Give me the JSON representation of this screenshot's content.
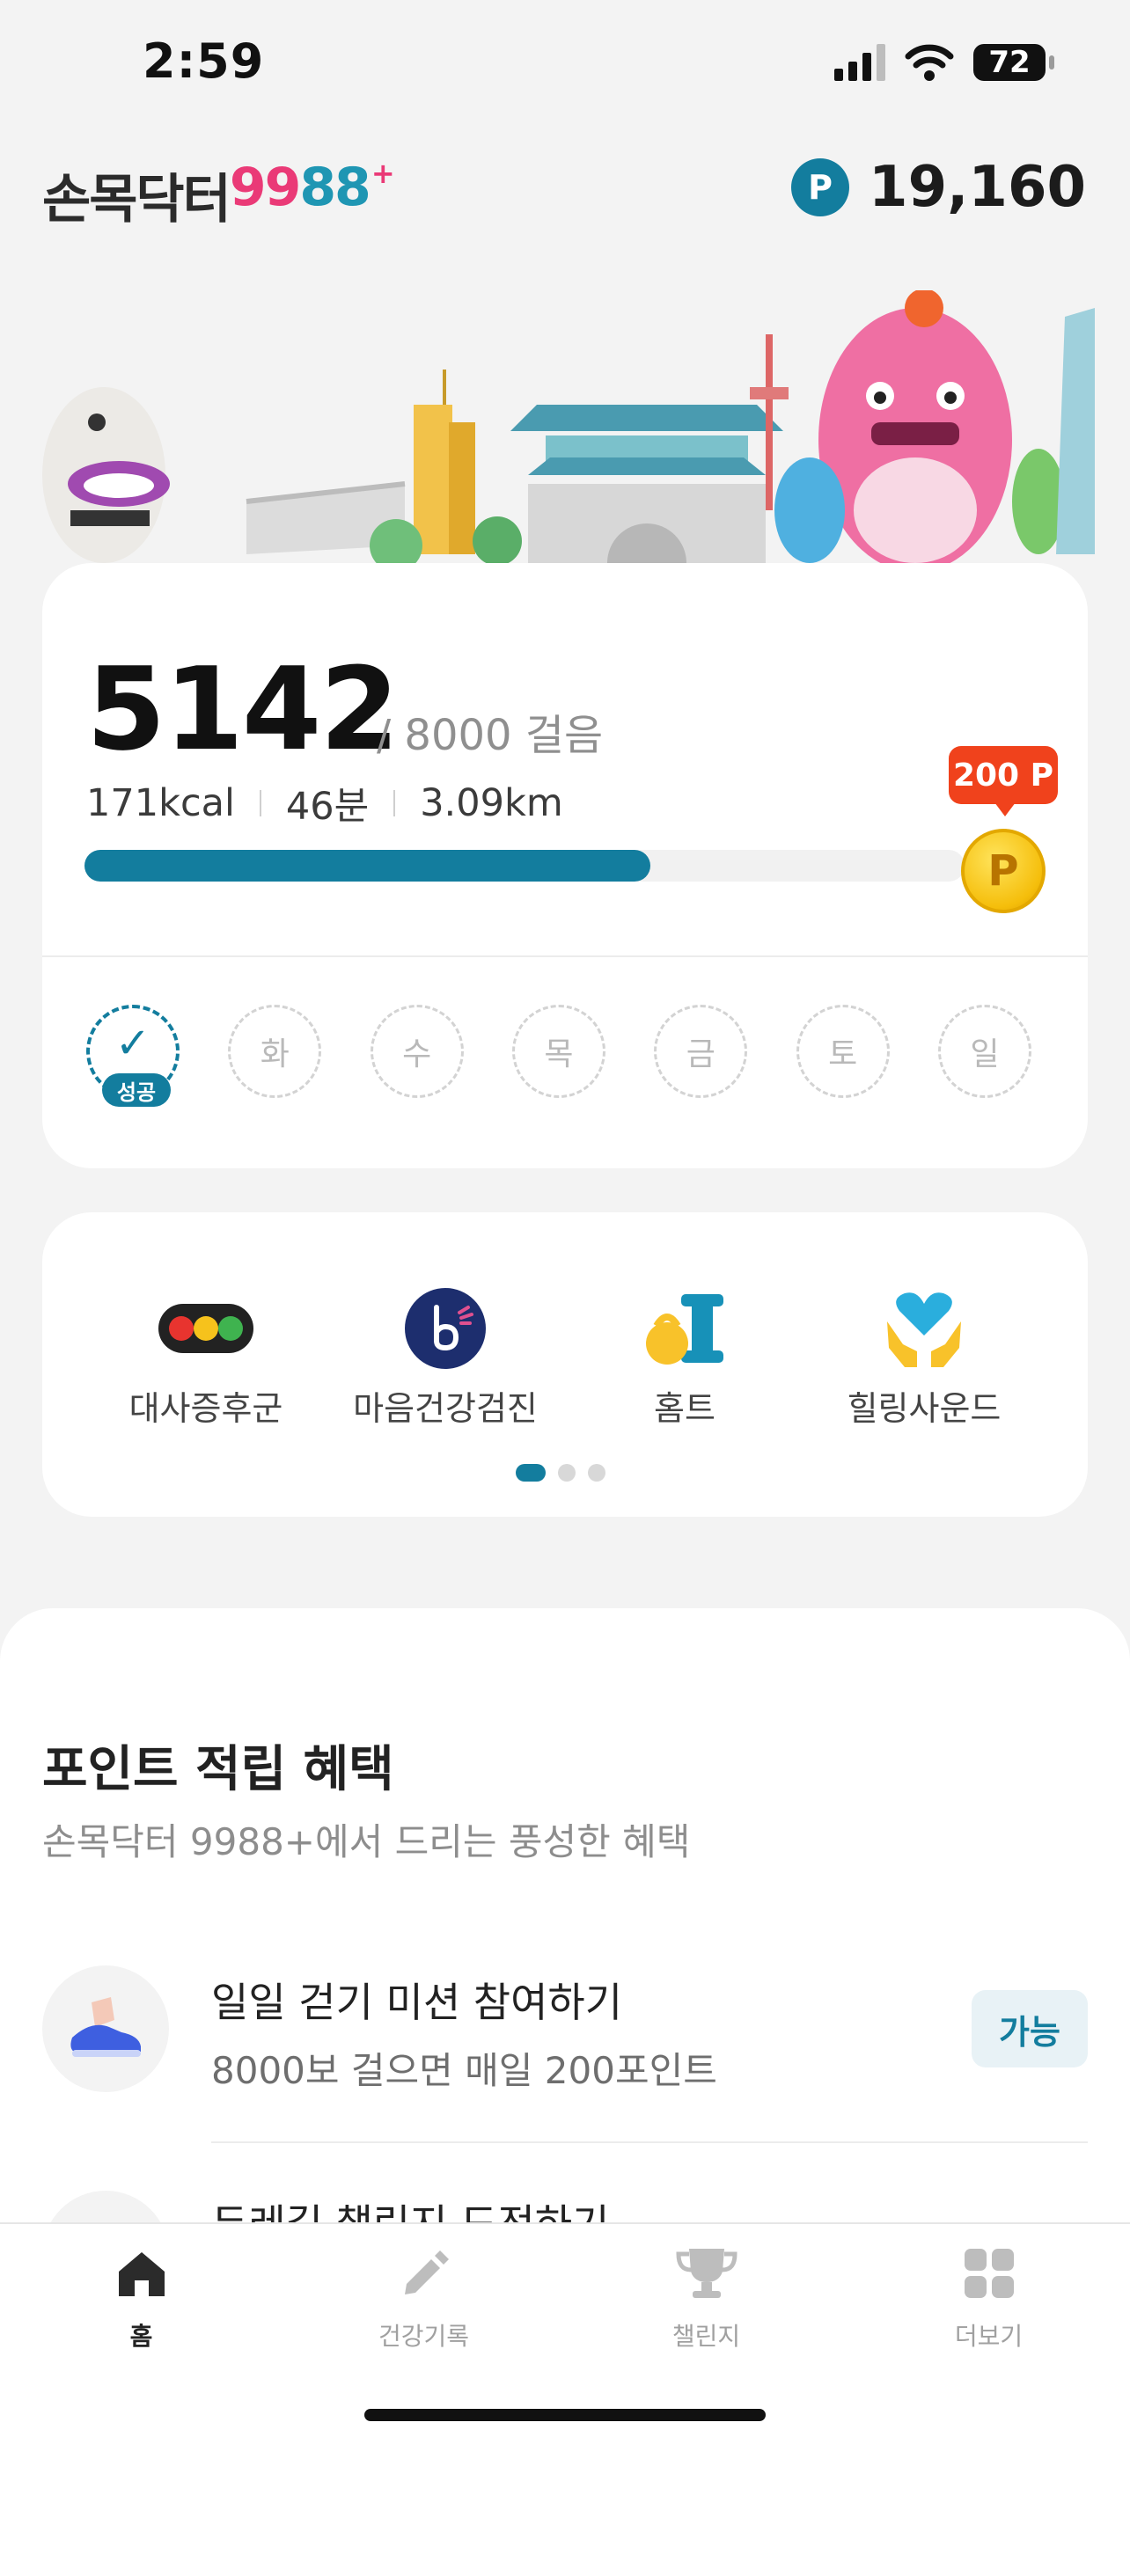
{
  "status_bar": {
    "time": "2:59",
    "battery": "72"
  },
  "header": {
    "logo_korean": "손목닥터",
    "logo_9a": "9",
    "logo_9b": "9",
    "logo_88": "88",
    "logo_plus": "+",
    "points_badge": "P",
    "points_value": "19,160"
  },
  "steps_card": {
    "steps": "5142",
    "goal": "/ 8000 걸음",
    "kcal": "171kcal",
    "minutes": "46분",
    "distance": "3.09km",
    "progress": 0.6427,
    "reward_tag": "200 P",
    "coin_label": "P",
    "days": [
      {
        "label": "성공",
        "done": true
      },
      {
        "label": "화",
        "done": false
      },
      {
        "label": "수",
        "done": false
      },
      {
        "label": "목",
        "done": false
      },
      {
        "label": "금",
        "done": false
      },
      {
        "label": "토",
        "done": false
      },
      {
        "label": "일",
        "done": false
      }
    ],
    "done_mark": "✓"
  },
  "shortcuts": {
    "items": [
      {
        "label": "대사증후군",
        "icon": "traffic-light-icon"
      },
      {
        "label": "마음건강검진",
        "icon": "mind-check-icon"
      },
      {
        "label": "홈트",
        "icon": "kettlebell-icon"
      },
      {
        "label": "힐링사운드",
        "icon": "heart-hands-icon"
      }
    ],
    "page_index": 0,
    "page_count": 3
  },
  "benefits": {
    "title": "포인트 적립 혜택",
    "subtitle": "손목닥터 9988+에서 드리는 풍성한 혜택",
    "items": [
      {
        "title": "일일 걷기 미션 참여하기",
        "desc": "8000보 걸으면 매일 200포인트",
        "badge": "가능",
        "icon": "sneaker-icon"
      },
      {
        "title": "두레길 챌린지 도전하기",
        "icon": "flag-icon"
      }
    ]
  },
  "tabbar": {
    "tabs": [
      {
        "label": "홈",
        "icon": "home-icon",
        "active": true
      },
      {
        "label": "건강기록",
        "icon": "pencil-icon",
        "active": false
      },
      {
        "label": "챌린지",
        "icon": "trophy-icon",
        "active": false
      },
      {
        "label": "더보기",
        "icon": "grid-icon",
        "active": false
      }
    ]
  },
  "colors": {
    "accent": "#137d9e",
    "reward": "#f0421c",
    "coin": "#f5be0b"
  }
}
